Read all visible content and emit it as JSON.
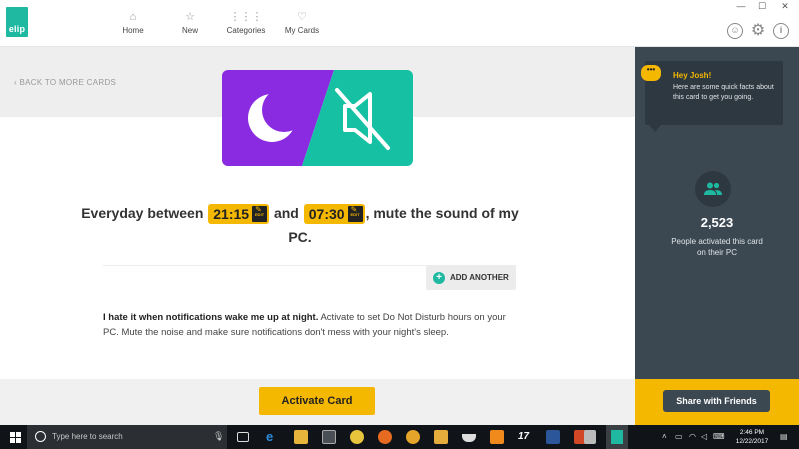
{
  "app": {
    "logo_text": "elip",
    "nav": [
      {
        "label": "Home",
        "icon": "home-icon"
      },
      {
        "label": "New",
        "icon": "star-icon"
      },
      {
        "label": "Categories",
        "icon": "grid-icon"
      },
      {
        "label": "My Cards",
        "icon": "heart-icon"
      }
    ],
    "top_icons": [
      "smiley-icon",
      "gear-icon",
      "info-icon"
    ]
  },
  "card": {
    "back_label": "BACK TO MORE CARDS",
    "headline_prefix": "Everyday between",
    "time_start": "21:15",
    "headline_mid": "and",
    "time_end": "07:30",
    "headline_suffix": ", mute the sound of my PC.",
    "edit_label": "EDIT",
    "add_another_label": "ADD ANOTHER",
    "desc_bold": "I hate it when notifications wake me up at night.",
    "desc_text": " Activate to set Do Not Disturb hours on your PC. Mute the noise and make sure notifications don't mess with your night's sleep.",
    "activate_label": "Activate Card",
    "art_colors": {
      "left": "#8a2be2",
      "right": "#16c1a3"
    }
  },
  "sidebar": {
    "tip_title": "Hey Josh!",
    "tip_text": "Here are some quick facts about this card to get you going.",
    "stat_value": "2,523",
    "stat_label": "People activated this card on their PC",
    "share_label": "Share with Friends"
  },
  "taskbar": {
    "search_placeholder": "Type here to search",
    "time": "2:46 PM",
    "date": "12/22/2017"
  },
  "colors": {
    "accent_yellow": "#f5b800",
    "accent_teal": "#1fb9a2",
    "sidebar_bg": "#3b4852"
  }
}
